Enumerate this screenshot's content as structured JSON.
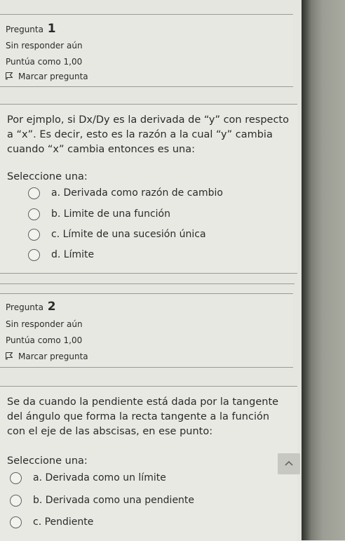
{
  "questions": [
    {
      "title_prefix": "Pregunta",
      "number": "1",
      "status": "Sin responder aún",
      "score": "Puntúa como 1,00",
      "flag_label": "Marcar pregunta",
      "text": "Por ejmplo, si Dx/Dy es la derivada de “y” con respecto a “x”. Es decir, esto es la razón a la cual “y” cambia cuando “x” cambia entonces es una:",
      "select_label": "Seleccione una:",
      "options": [
        "a. Derivada como razón de cambio",
        "b. Limite de una función",
        "c. Límite de una sucesión única",
        "d. Límite"
      ]
    },
    {
      "title_prefix": "Pregunta",
      "number": "2",
      "status": "Sin responder aún",
      "score": "Puntúa como 1,00",
      "flag_label": "Marcar pregunta",
      "text": "Se da cuando la pendiente está dada por la tangente del ángulo que forma la recta tangente a la función con el eje de las abscisas, en ese punto:",
      "select_label": "Seleccione una:",
      "options": [
        "a. Derivada como un límite",
        "b. Derivada como una pendiente",
        "c. Pendiente"
      ]
    }
  ]
}
